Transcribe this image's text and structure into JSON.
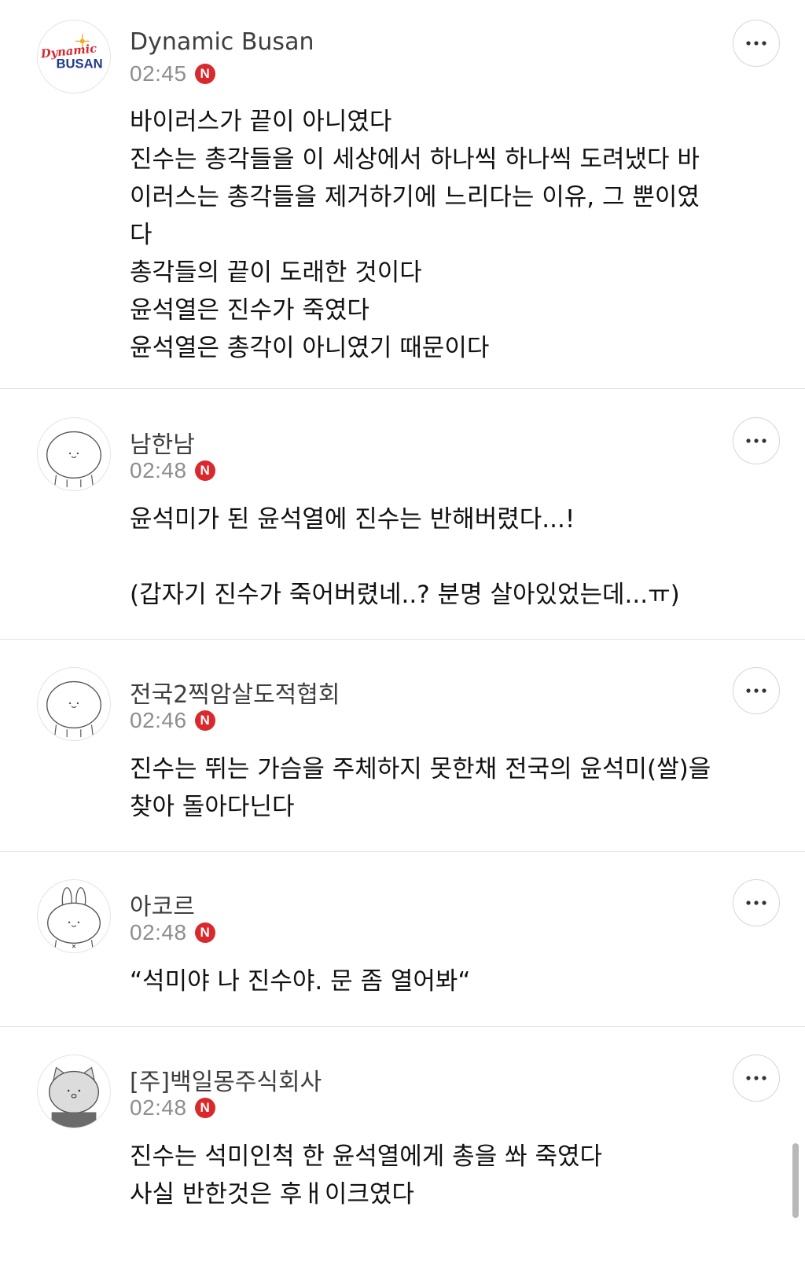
{
  "comments": [
    {
      "username": "Dynamic Busan",
      "time": "02:45",
      "badge": "N",
      "avatar": "dynamic-busan-logo",
      "avatar_text_1": "Dynamic",
      "avatar_text_2": "BUSAN",
      "lines": [
        "바이러스가 끝이 아니였다",
        "진수는 총각들을 이 세상에서 하나씩 하나씩 도려냈다 바",
        "이러스는 총각들을 제거하기에 느리다는 이유, 그 뿐이였",
        "다",
        "총각들의 끝이 도래한 것이다",
        "윤석열은 진수가 죽였다",
        "윤석열은 총각이 아니였기 때문이다"
      ]
    },
    {
      "username": "남한남",
      "time": "02:48",
      "badge": "N",
      "avatar": "default-face-avatar",
      "lines": [
        "윤석미가 된 윤석열에 진수는 반해버렸다...!",
        "",
        "(갑자기 진수가 죽어버렸네..? 분명 살아있었는데...ㅠ)"
      ]
    },
    {
      "username": "전국2찍암살도적협회",
      "time": "02:46",
      "badge": "N",
      "avatar": "default-face-avatar",
      "lines": [
        "진수는 뛰는 가슴을 주체하지 못한채 전국의 윤석미(쌀)을",
        "찾아 돌아다닌다"
      ]
    },
    {
      "username": "아코르",
      "time": "02:48",
      "badge": "N",
      "avatar": "rabbit-avatar",
      "lines": [
        "“석미야 나 진수야. 문 좀 열어봐“"
      ]
    },
    {
      "username": "[주]백일몽주식회사",
      "time": "02:48",
      "badge": "N",
      "avatar": "cat-avatar",
      "lines": [
        "진수는 석미인척 한 윤석열에게 총을 쏴 죽였다",
        "사실 반한것은 후ㅐ이크였다"
      ]
    }
  ],
  "colors": {
    "badge": "#d9292d",
    "time": "#8e8e8e",
    "username": "#3f3f3f",
    "divider": "#e3e3e3",
    "busan_red": "#d8262d",
    "busan_navy": "#1f3a8a"
  },
  "icons": {
    "more": "more-horizontal-icon",
    "badge": "n-badge-icon"
  }
}
